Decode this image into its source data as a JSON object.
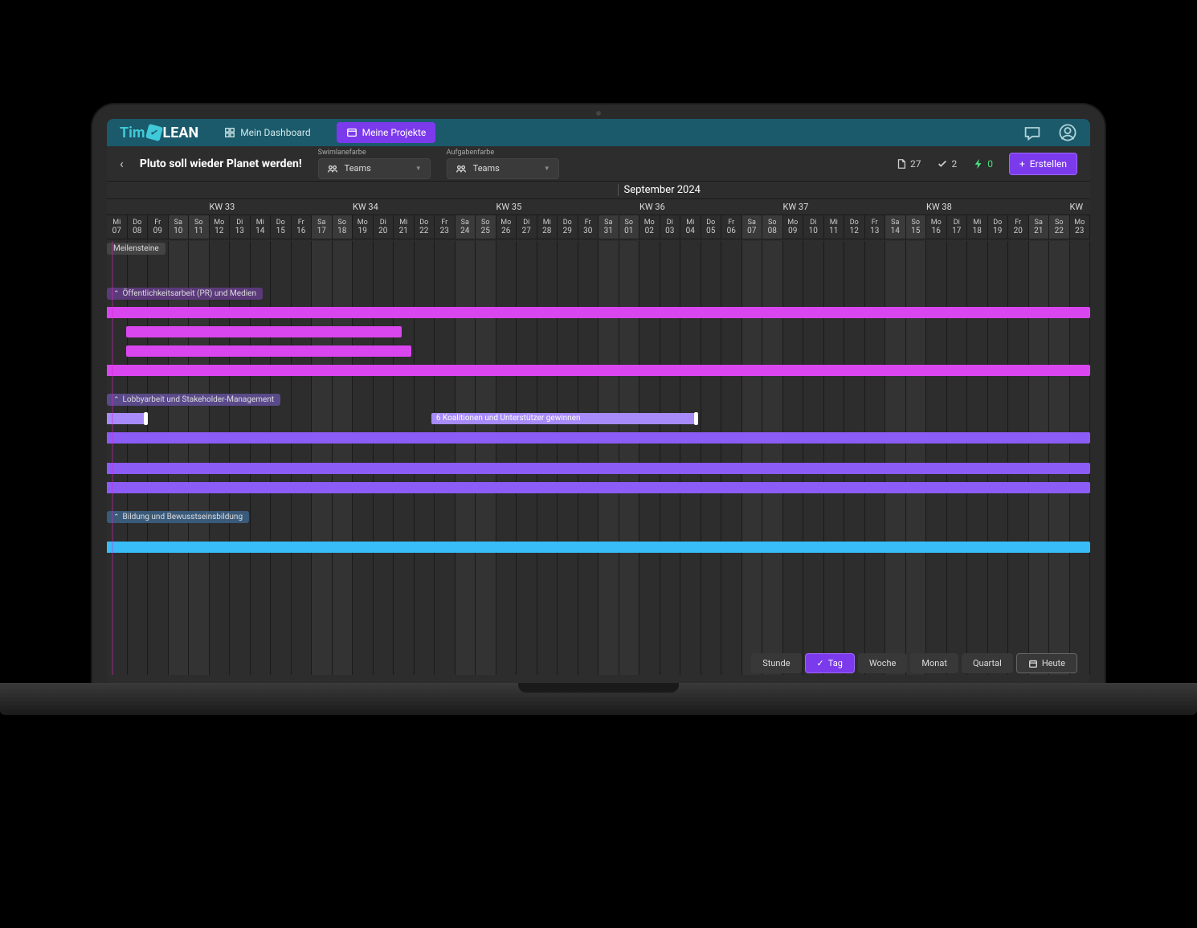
{
  "logo": {
    "part1": "Tim",
    "part2": "LEAN"
  },
  "nav": [
    {
      "icon": "dashboard",
      "label": "Mein Dashboard",
      "active": false
    },
    {
      "icon": "projects",
      "label": "Meine Projekte",
      "active": true
    }
  ],
  "project_title": "Pluto soll wieder Planet werden!",
  "dropdowns": [
    {
      "label": "Swimlanefarbe",
      "value": "Teams"
    },
    {
      "label": "Aufgabenfarbe",
      "value": "Teams"
    }
  ],
  "stats": {
    "docs": "27",
    "checks": "2",
    "bolts": "0"
  },
  "create_label": "Erstellen",
  "month_label": "September 2024",
  "weeks": [
    "KW 33",
    "KW 34",
    "KW 35",
    "KW 36",
    "KW 37",
    "KW 38",
    "KW"
  ],
  "days": [
    {
      "n": "Mi",
      "d": "07"
    },
    {
      "n": "Do",
      "d": "08"
    },
    {
      "n": "Fr",
      "d": "09"
    },
    {
      "n": "Sa",
      "d": "10",
      "w": true
    },
    {
      "n": "So",
      "d": "11",
      "w": true
    },
    {
      "n": "Mo",
      "d": "12"
    },
    {
      "n": "Di",
      "d": "13"
    },
    {
      "n": "Mi",
      "d": "14"
    },
    {
      "n": "Do",
      "d": "15"
    },
    {
      "n": "Fr",
      "d": "16"
    },
    {
      "n": "Sa",
      "d": "17",
      "w": true
    },
    {
      "n": "So",
      "d": "18",
      "w": true
    },
    {
      "n": "Mo",
      "d": "19"
    },
    {
      "n": "Di",
      "d": "20"
    },
    {
      "n": "Mi",
      "d": "21"
    },
    {
      "n": "Do",
      "d": "22"
    },
    {
      "n": "Fr",
      "d": "23"
    },
    {
      "n": "Sa",
      "d": "24",
      "w": true
    },
    {
      "n": "So",
      "d": "25",
      "w": true
    },
    {
      "n": "Mo",
      "d": "26"
    },
    {
      "n": "Di",
      "d": "27"
    },
    {
      "n": "Mi",
      "d": "28"
    },
    {
      "n": "Do",
      "d": "29"
    },
    {
      "n": "Fr",
      "d": "30"
    },
    {
      "n": "Sa",
      "d": "31",
      "w": true
    },
    {
      "n": "So",
      "d": "01",
      "w": true
    },
    {
      "n": "Mo",
      "d": "02"
    },
    {
      "n": "Di",
      "d": "03"
    },
    {
      "n": "Mi",
      "d": "04"
    },
    {
      "n": "Do",
      "d": "05"
    },
    {
      "n": "Fr",
      "d": "06"
    },
    {
      "n": "Sa",
      "d": "07",
      "w": true
    },
    {
      "n": "So",
      "d": "08",
      "w": true
    },
    {
      "n": "Mo",
      "d": "09"
    },
    {
      "n": "Di",
      "d": "10"
    },
    {
      "n": "Mi",
      "d": "11"
    },
    {
      "n": "Do",
      "d": "12"
    },
    {
      "n": "Fr",
      "d": "13"
    },
    {
      "n": "Sa",
      "d": "14",
      "w": true
    },
    {
      "n": "So",
      "d": "15",
      "w": true
    },
    {
      "n": "Mo",
      "d": "16"
    },
    {
      "n": "Di",
      "d": "17"
    },
    {
      "n": "Mi",
      "d": "18"
    },
    {
      "n": "Do",
      "d": "19"
    },
    {
      "n": "Fr",
      "d": "20"
    },
    {
      "n": "Sa",
      "d": "21",
      "w": true
    },
    {
      "n": "So",
      "d": "22",
      "w": true
    },
    {
      "n": "Mo",
      "d": "23"
    }
  ],
  "swimlanes": [
    {
      "label": "Meilensteine",
      "class": ""
    },
    {
      "label": "Öffentlichkeitsarbeit (PR) und Medien",
      "class": "purple"
    },
    {
      "label": "Lobbyarbeit und Stakeholder-Management",
      "class": "violet"
    },
    {
      "label": "Bildung und Bewusstseinsbildung",
      "class": "blue"
    }
  ],
  "task_label": "6 Koalitionen und Unterstützer gewinnen",
  "view_buttons": [
    "Stunde",
    "Tag",
    "Woche",
    "Monat",
    "Quartal"
  ],
  "view_active": "Tag",
  "today_label": "Heute",
  "colors": {
    "pink": "#d946ef",
    "violet": "#8b5cf6",
    "lightviolet": "#a78bfa",
    "blue": "#38bdf8",
    "accent": "#7c3aed"
  }
}
